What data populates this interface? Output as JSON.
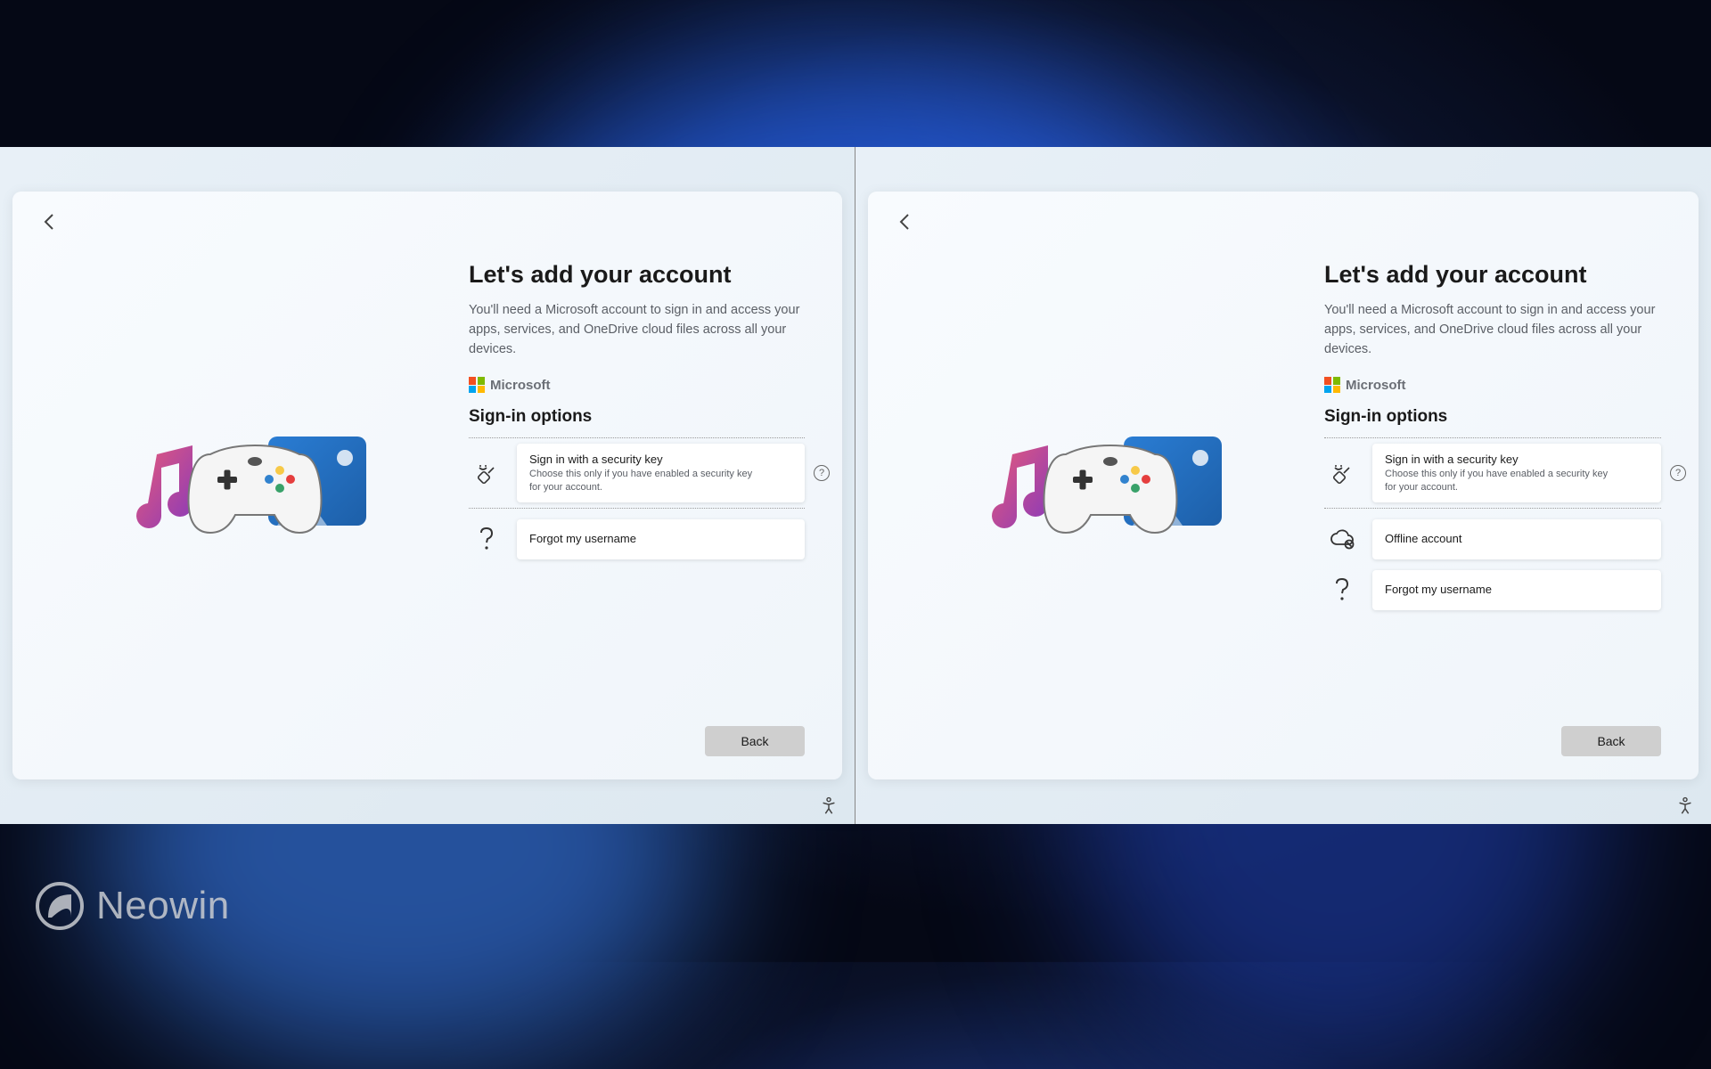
{
  "heading": "Let's add your account",
  "subtitle": "You'll need a Microsoft account to sign in and access your apps, services, and OneDrive cloud files across all your devices.",
  "brand": "Microsoft",
  "section_title": "Sign-in options",
  "security_key": {
    "title": "Sign in with a security key",
    "desc": "Choose this only if you have enabled a security key for your account."
  },
  "offline": {
    "label": "Offline account"
  },
  "forgot": {
    "label": "Forgot my username"
  },
  "back_button": "Back",
  "watermark": "Neowin"
}
